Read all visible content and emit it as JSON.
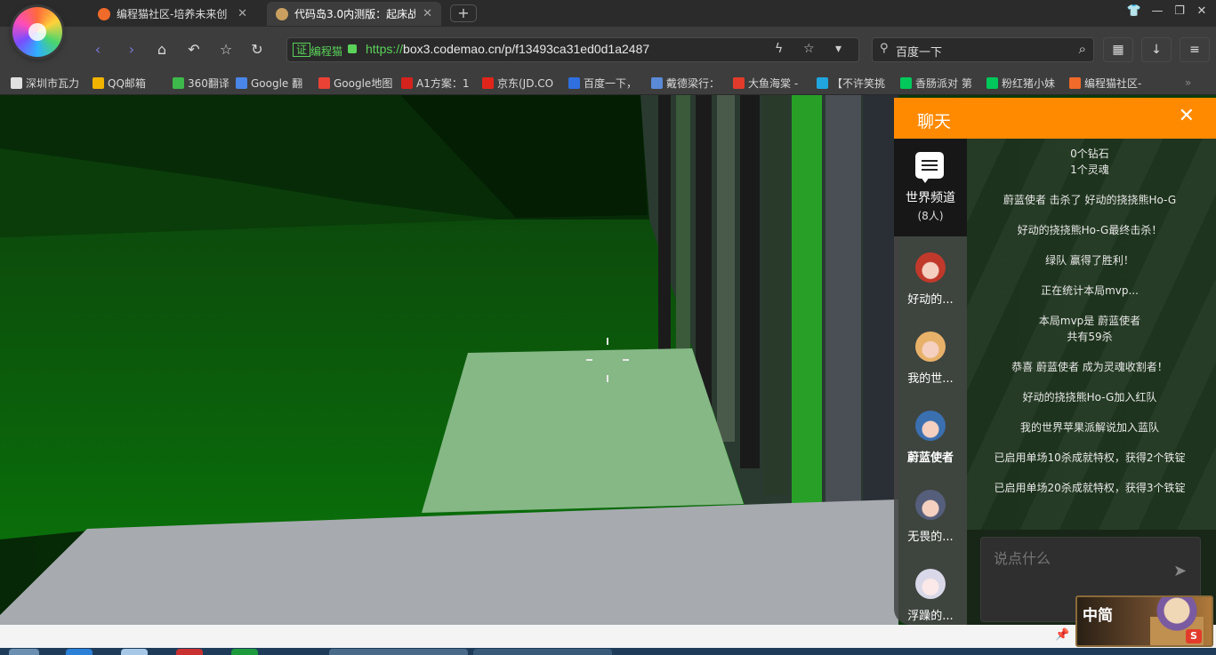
{
  "tabs": [
    {
      "title": "编程猫社区-培养未来创",
      "active": false
    },
    {
      "title": "代码岛3.0内测版：起床战",
      "active": true
    }
  ],
  "toolbar": {
    "address_cert": "证",
    "address_site": "编程猫",
    "url_scheme": "https://",
    "url_rest": "box3.codemao.cn/p/f13493ca31ed0d1a2487",
    "search_text": "百度一下"
  },
  "bookmarks": [
    {
      "label": "深圳市瓦力",
      "icon": "page-icon",
      "color": "#e0e0e0"
    },
    {
      "label": "QQ邮箱",
      "icon": "qq-icon",
      "color": "#f0b400"
    },
    {
      "label": "360翻译",
      "icon": "360-icon",
      "color": "#3cb94a"
    },
    {
      "label": "Google 翻",
      "icon": "google-translate-icon",
      "color": "#4a86e8"
    },
    {
      "label": "Google地图",
      "icon": "google-icon",
      "color": "#ea4335"
    },
    {
      "label": "A1方案：1",
      "icon": "a1-icon",
      "color": "#d4221c"
    },
    {
      "label": "京东(JD.CO",
      "icon": "jd-icon",
      "color": "#e1251b"
    },
    {
      "label": "百度一下，",
      "icon": "baidu-icon",
      "color": "#2f6fe0"
    },
    {
      "label": "戴德梁行：",
      "icon": "dtz-icon",
      "color": "#5a8ad6"
    },
    {
      "label": "大鱼海棠 -",
      "icon": "le-icon",
      "color": "#e23b2b"
    },
    {
      "label": "【不许笑挑",
      "icon": "bilibili-icon",
      "color": "#21a5de"
    },
    {
      "label": "香肠派对 第",
      "icon": "iqiyi-icon",
      "color": "#00c85a"
    },
    {
      "label": "粉红猪小妹",
      "icon": "iqiyi-icon",
      "color": "#00c85a"
    },
    {
      "label": "编程猫社区-",
      "icon": "codemao-icon",
      "color": "#f06a2a"
    }
  ],
  "chat": {
    "title": "聊天",
    "world_channel": "世界频道",
    "world_count": "(8人)",
    "players": [
      {
        "name": "好动的...",
        "color": "#c0392b"
      },
      {
        "name": "我的世...",
        "color": "#e8b16a"
      },
      {
        "name": "蔚蓝使者",
        "color": "#3a6fb0"
      },
      {
        "name": "无畏的...",
        "color": "#555e7a"
      },
      {
        "name": "浮躁的...",
        "color": "#d8d8e8"
      }
    ],
    "messages": [
      {
        "lines": [
          "0个钻石",
          "1个灵魂"
        ]
      },
      {
        "lines": [
          "蔚蓝使者 击杀了 好动的挠挠熊Ho-G"
        ]
      },
      {
        "lines": [
          "好动的挠挠熊Ho-G最终击杀！"
        ]
      },
      {
        "lines": [
          "绿队 赢得了胜利！"
        ]
      },
      {
        "lines": [
          "正在统计本局mvp..."
        ]
      },
      {
        "lines": [
          "本局mvp是 蔚蓝使者",
          "共有59杀"
        ]
      },
      {
        "lines": [
          "恭喜 蔚蓝使者 成为灵魂收割者！"
        ]
      },
      {
        "lines": [
          "好动的挠挠熊Ho-G加入红队"
        ]
      },
      {
        "lines": [
          "我的世界苹果派解说加入蓝队"
        ]
      },
      {
        "lines": [
          "已启用单场10杀成就特权，获得2个铁锭"
        ]
      },
      {
        "lines": [
          "已启用单场20杀成就特权，获得3个铁锭"
        ]
      }
    ],
    "input_placeholder": "说点什么"
  },
  "ime": {
    "label": "中简"
  }
}
